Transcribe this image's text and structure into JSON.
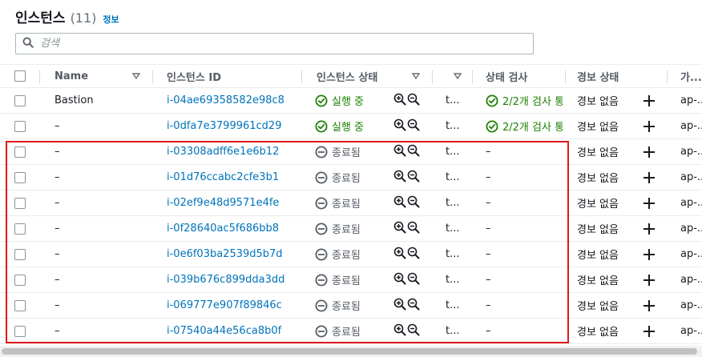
{
  "header": {
    "title": "인스턴스",
    "count": "(11)",
    "info_link": "정보"
  },
  "search": {
    "placeholder": "검색"
  },
  "columns": {
    "name": "Name",
    "instance_id": "인스턴스 ID",
    "instance_state": "인스턴스 상태",
    "status_check": "상태 검사",
    "alarm_status": "경보 상태",
    "availability_zone": "가..."
  },
  "rows": [
    {
      "name": "Bastion",
      "id": "i-04ae69358582e98c8",
      "state": "실행 중",
      "state_kind": "running",
      "type": "t...",
      "check": "2/2개 검사 통",
      "check_kind": "ok",
      "alarm": "경보 없음",
      "az": "ap-..."
    },
    {
      "name": "–",
      "id": "i-0dfa7e3799961cd29",
      "state": "실행 중",
      "state_kind": "running",
      "type": "t...",
      "check": "2/2개 검사 통",
      "check_kind": "ok",
      "alarm": "경보 없음",
      "az": "ap-..."
    },
    {
      "name": "–",
      "id": "i-03308adff6e1e6b12",
      "state": "종료됨",
      "state_kind": "terminated",
      "type": "t...",
      "check": "–",
      "check_kind": "none",
      "alarm": "경보 없음",
      "az": "ap-..."
    },
    {
      "name": "–",
      "id": "i-01d76ccabc2cfe3b1",
      "state": "종료됨",
      "state_kind": "terminated",
      "type": "t...",
      "check": "–",
      "check_kind": "none",
      "alarm": "경보 없음",
      "az": "ap-..."
    },
    {
      "name": "–",
      "id": "i-02ef9e48d9571e4fe",
      "state": "종료됨",
      "state_kind": "terminated",
      "type": "t...",
      "check": "–",
      "check_kind": "none",
      "alarm": "경보 없음",
      "az": "ap-..."
    },
    {
      "name": "–",
      "id": "i-0f28640ac5f686bb8",
      "state": "종료됨",
      "state_kind": "terminated",
      "type": "t...",
      "check": "–",
      "check_kind": "none",
      "alarm": "경보 없음",
      "az": "ap-..."
    },
    {
      "name": "–",
      "id": "i-0e6f03ba2539d5b7d",
      "state": "종료됨",
      "state_kind": "terminated",
      "type": "t...",
      "check": "–",
      "check_kind": "none",
      "alarm": "경보 없음",
      "az": "ap-..."
    },
    {
      "name": "–",
      "id": "i-039b676c899dda3dd",
      "state": "종료됨",
      "state_kind": "terminated",
      "type": "t...",
      "check": "–",
      "check_kind": "none",
      "alarm": "경보 없음",
      "az": "ap-..."
    },
    {
      "name": "–",
      "id": "i-069777e907f89846c",
      "state": "종료됨",
      "state_kind": "terminated",
      "type": "t...",
      "check": "–",
      "check_kind": "none",
      "alarm": "경보 없음",
      "az": "ap-..."
    },
    {
      "name": "–",
      "id": "i-07540a44e56ca8b0f",
      "state": "종료됨",
      "state_kind": "terminated",
      "type": "t...",
      "check": "–",
      "check_kind": "none",
      "alarm": "경보 없음",
      "az": "ap-..."
    }
  ],
  "colors": {
    "link": "#0073bb",
    "ok": "#1d8102",
    "highlight": "#e0161a"
  },
  "icons": {
    "search": "search-icon",
    "running": "check-circle-icon",
    "terminated": "minus-circle-icon",
    "zoom_in": "zoom-in-icon",
    "zoom_out": "zoom-out-icon",
    "add_alarm": "plus-icon",
    "sort": "caret-down-icon"
  }
}
